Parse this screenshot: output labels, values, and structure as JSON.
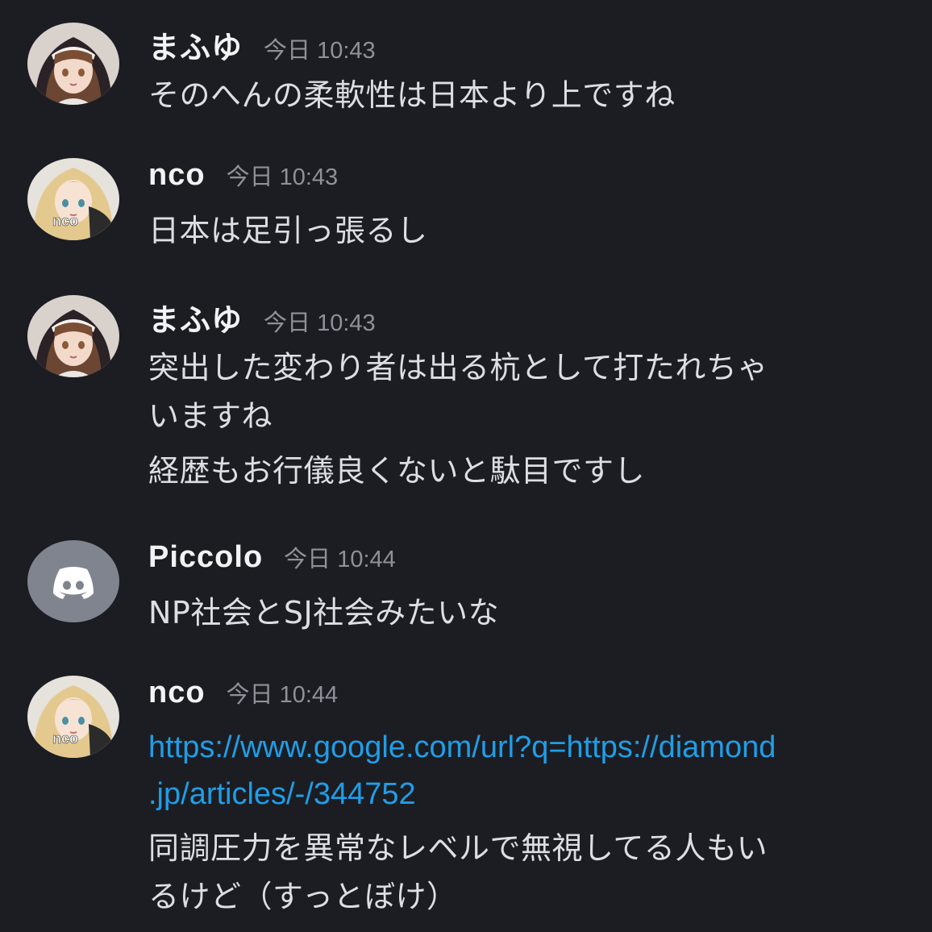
{
  "messages": [
    {
      "username": "まふゆ",
      "timestamp": "今日 10:43",
      "avatar": "nun-girl-avatar",
      "lines": [
        "そのへんの柔軟性は日本より上ですね"
      ]
    },
    {
      "username": "nco",
      "timestamp": "今日 10:43",
      "avatar": "blonde-girl-avatar",
      "avatar_text": "nco",
      "lines": [
        "日本は足引っ張るし"
      ]
    },
    {
      "username": "まふゆ",
      "timestamp": "今日 10:43",
      "avatar": "nun-girl-avatar",
      "lines": [
        "突出した変わり者は出る杭として打たれちゃ",
        "いますね",
        "経歴もお行儀良くないと駄目ですし"
      ]
    },
    {
      "username": "Piccolo",
      "timestamp": "今日 10:44",
      "avatar": "discord-logo-avatar",
      "lines": [
        "NP社会とSJ社会みたいな"
      ]
    },
    {
      "username": "nco",
      "timestamp": "今日 10:44",
      "avatar": "blonde-girl-avatar",
      "avatar_text": "nco",
      "link_lines": [
        "https://www.google.com/url?q=https://diamond",
        ".jp/articles/-/344752"
      ],
      "lines": [
        "同調圧力を異常なレベルで無視してる人もい",
        "るけど（すっとぼけ）"
      ]
    }
  ],
  "colors": {
    "background": "#1c1d22",
    "username": "#f2f3f5",
    "timestamp": "#8e9199",
    "text": "#dcdee3",
    "link": "#1f9ee8",
    "discord_avatar_bg": "#80848e"
  }
}
